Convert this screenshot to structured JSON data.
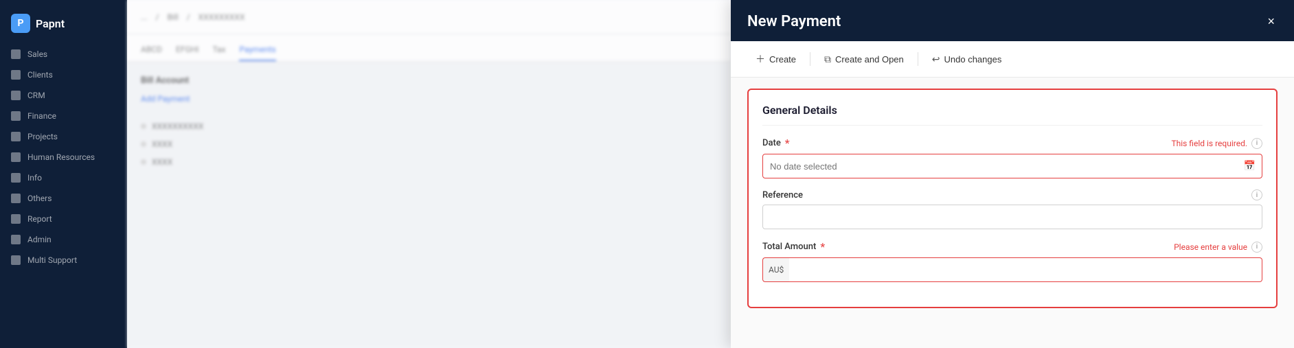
{
  "sidebar": {
    "logo": {
      "icon": "P",
      "text": "Papnt"
    },
    "items": [
      {
        "label": "Sales",
        "id": "sales"
      },
      {
        "label": "Clients",
        "id": "clients"
      },
      {
        "label": "CRM",
        "id": "crm"
      },
      {
        "label": "Finance",
        "id": "finance"
      },
      {
        "label": "Projects",
        "id": "projects"
      },
      {
        "label": "Human Resources",
        "id": "hr"
      },
      {
        "label": "Info",
        "id": "info"
      },
      {
        "label": "Others",
        "id": "others"
      },
      {
        "label": "Report",
        "id": "report"
      },
      {
        "label": "Admin",
        "id": "admin"
      },
      {
        "label": "Multi Support",
        "id": "multi-support"
      }
    ]
  },
  "breadcrumb": {
    "parts": [
      "...",
      "Bill",
      "XXXXXXXXX"
    ]
  },
  "main": {
    "tabs": [
      {
        "label": "ABCD",
        "active": false
      },
      {
        "label": "EFGHI",
        "active": false
      },
      {
        "label": "Tax",
        "active": false
      },
      {
        "label": "Payments",
        "active": true
      }
    ],
    "section_heading": "Bill Account",
    "add_link": "Add Payment",
    "list_items": [
      {
        "text": "XXXXXXXXXX"
      },
      {
        "text": "XXXX"
      },
      {
        "text": "XXXX"
      }
    ]
  },
  "panel": {
    "title": "New Payment",
    "close_label": "×",
    "toolbar": {
      "create_label": "Create",
      "create_and_open_label": "Create and Open",
      "undo_label": "Undo changes"
    },
    "general_details": {
      "section_title": "General Details",
      "date_label": "Date",
      "date_required": true,
      "date_placeholder": "No date selected",
      "date_error": "This field is required.",
      "reference_label": "Reference",
      "reference_placeholder": "",
      "total_amount_label": "Total Amount",
      "total_amount_required": true,
      "total_amount_error": "Please enter a value",
      "currency_prefix": "AU$",
      "total_amount_placeholder": ""
    }
  },
  "colors": {
    "sidebar_bg": "#0f1f38",
    "accent": "#2563eb",
    "error": "#e53e3e",
    "panel_header_bg": "#0f1f38"
  }
}
